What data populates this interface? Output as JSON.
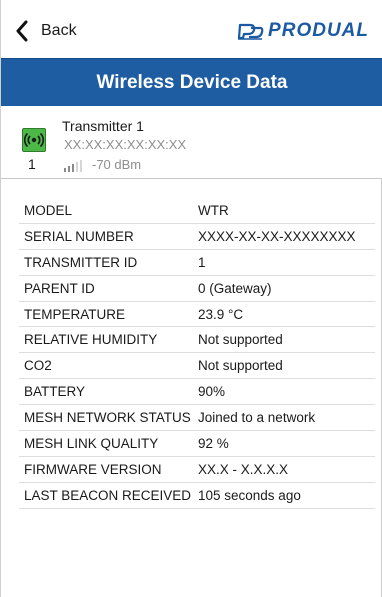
{
  "header": {
    "back_label": "Back",
    "logo_text": "PRODUAL",
    "brand_color": "#1b5aa3"
  },
  "title": "Wireless Device Data",
  "device": {
    "name": "Transmitter 1",
    "mac": "XX:XX:XX:XX:XX:XX",
    "index": "1",
    "signal": "-70 dBm",
    "signal_bars_lit": 3,
    "icon": "wireless-transmitter-icon",
    "icon_color": "#4cb848"
  },
  "rows": [
    {
      "key": "MODEL",
      "value": "WTR"
    },
    {
      "key": "SERIAL NUMBER",
      "value": "XXXX-XX-XX-XXXXXXXX"
    },
    {
      "key": "TRANSMITTER ID",
      "value": "1"
    },
    {
      "key": "PARENT ID",
      "value": "0 (Gateway)"
    },
    {
      "key": "TEMPERATURE",
      "value": "23.9 °C"
    },
    {
      "key": "RELATIVE HUMIDITY",
      "value": "Not supported"
    },
    {
      "key": "CO2",
      "value": "Not supported"
    },
    {
      "key": "BATTERY",
      "value": "90%"
    },
    {
      "key": "MESH NETWORK STATUS",
      "value": "Joined to a network"
    },
    {
      "key": "MESH LINK QUALITY",
      "value": "92 %"
    },
    {
      "key": "FIRMWARE VERSION",
      "value": "XX.X - X.X.X.X"
    },
    {
      "key": "LAST BEACON RECEIVED",
      "value": "105 seconds ago"
    }
  ]
}
